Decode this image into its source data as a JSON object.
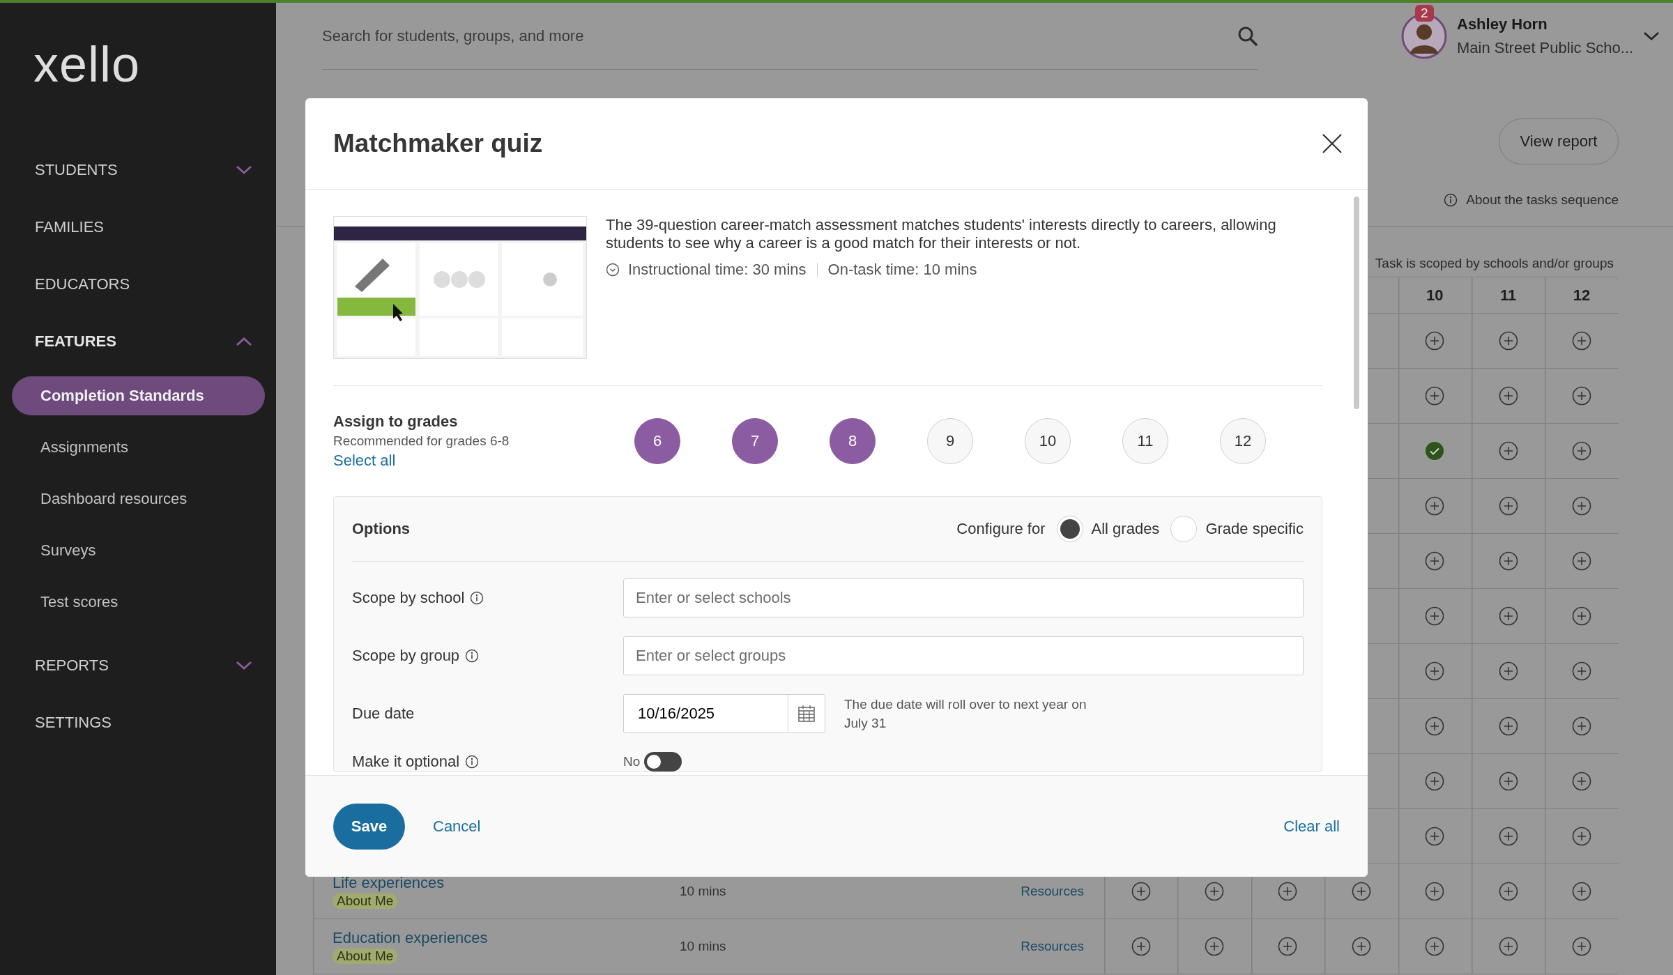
{
  "sidebar": {
    "logo": "xello",
    "items": [
      {
        "label": "STUDENTS",
        "expanded": false
      },
      {
        "label": "FAMILIES"
      },
      {
        "label": "EDUCATORS"
      },
      {
        "label": "FEATURES",
        "expanded": true,
        "children": [
          {
            "label": "Completion Standards",
            "selected": true
          },
          {
            "label": "Assignments",
            "selected": false
          },
          {
            "label": "Dashboard resources",
            "selected": false
          },
          {
            "label": "Surveys",
            "selected": false
          },
          {
            "label": "Test scores",
            "selected": false
          }
        ]
      },
      {
        "label": "REPORTS",
        "expanded": false
      },
      {
        "label": "SETTINGS"
      }
    ]
  },
  "search": {
    "placeholder": "Search for students, groups, and more"
  },
  "user": {
    "name": "Ashley Horn",
    "school": "Main Street Public Scho...",
    "notifications": "2"
  },
  "view_report": "View report",
  "about_link": "About the tasks sequence",
  "scope_note": "Task is scoped by schools and/or groups",
  "table": {
    "grade_headers": [
      "10",
      "11",
      "12"
    ],
    "rows": [
      {
        "assigned": [
          false,
          false,
          false
        ]
      },
      {
        "assigned": [
          false,
          false,
          false
        ]
      },
      {
        "assigned": [
          true,
          false,
          false
        ]
      },
      {
        "assigned": [
          false,
          false,
          false
        ]
      },
      {
        "assigned": [
          false,
          false,
          false
        ]
      },
      {
        "assigned": [
          false,
          false,
          false
        ]
      },
      {
        "assigned": [
          false,
          false,
          false
        ]
      },
      {
        "assigned": [
          false,
          false,
          false
        ]
      },
      {
        "assigned": [
          false,
          false,
          false
        ]
      },
      {
        "assigned": [
          false,
          false,
          false
        ]
      },
      {
        "task": "Life experiences",
        "tag": "About Me",
        "time": "10 mins",
        "resources": "Resources",
        "assigned": [
          false,
          false,
          false,
          false,
          false,
          false,
          false
        ]
      },
      {
        "task": "Education experiences",
        "tag": "About Me",
        "time": "10 mins",
        "resources": "Resources",
        "assigned": [
          false,
          false,
          false,
          false,
          false,
          false,
          false
        ]
      }
    ]
  },
  "modal": {
    "title": "Matchmaker quiz",
    "description": "The 39-question career-match assessment matches students' interests directly to careers, allowing students to see why a career is a good match for their interests or not.",
    "instructional_time": "Instructional time: 30 mins",
    "on_task_time": "On-task time: 10 mins",
    "assign": {
      "heading": "Assign to grades",
      "recommendation": "Recommended for grades 6-8",
      "select_all": "Select all",
      "grades": [
        {
          "label": "6",
          "selected": true
        },
        {
          "label": "7",
          "selected": true
        },
        {
          "label": "8",
          "selected": true
        },
        {
          "label": "9",
          "selected": false
        },
        {
          "label": "10",
          "selected": false
        },
        {
          "label": "11",
          "selected": false
        },
        {
          "label": "12",
          "selected": false
        }
      ]
    },
    "options": {
      "heading": "Options",
      "configure_label": "Configure for",
      "configure_choices": [
        {
          "label": "All grades",
          "selected": true
        },
        {
          "label": "Grade specific",
          "selected": false
        }
      ],
      "fields": [
        {
          "kind": "select",
          "label": "Scope by school",
          "info": true,
          "placeholder": "Enter or select schools"
        },
        {
          "kind": "select",
          "label": "Scope by group",
          "info": true,
          "placeholder": "Enter or select groups"
        },
        {
          "kind": "date",
          "label": "Due date",
          "value": "10/16/2025",
          "note": "The due date will roll over to next year on July 31"
        },
        {
          "kind": "toggle",
          "label": "Make it optional",
          "info": true,
          "state_label": "No",
          "on": false
        }
      ]
    },
    "footer": {
      "save": "Save",
      "cancel": "Cancel",
      "clear": "Clear all"
    }
  }
}
